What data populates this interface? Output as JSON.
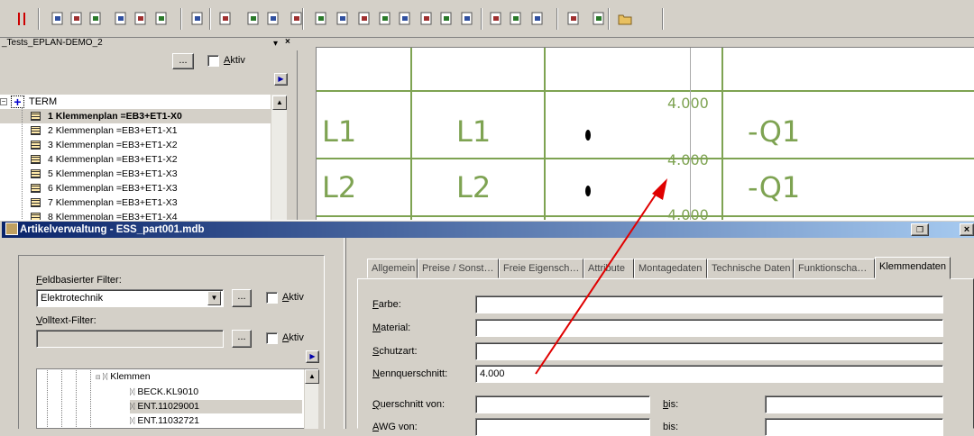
{
  "toolbar": {
    "icons": [
      "stop-icon",
      "copy-icon",
      "new-page-icon",
      "properties-icon",
      "move-up-icon",
      "move-down-icon",
      "move-right-icon",
      "table-icon",
      "report-icon",
      "select-icon",
      "connect-icon",
      "cross-ref-icon",
      "terminal-icon",
      "device-icon",
      "part-icon",
      "cable-icon",
      "plug-icon",
      "wire-icon",
      "edit-icon",
      "hatch-icon",
      "frame-icon",
      "window-icon",
      "window-text-icon",
      "cart-icon",
      "parts-db-icon",
      "open-folder-icon"
    ]
  },
  "panel": {
    "title": "_Tests_EPLAN-DEMO_2",
    "close": "×",
    "browse": "...",
    "aktiv": "Aktiv"
  },
  "tree": {
    "root": "TERM",
    "items": [
      "1 Klemmenplan =EB3+ET1-X0",
      "2 Klemmenplan =EB3+ET1-X1",
      "3 Klemmenplan =EB3+ET1-X2",
      "4 Klemmenplan =EB3+ET1-X2",
      "5 Klemmenplan =EB3+ET1-X3",
      "6 Klemmenplan =EB3+ET1-X3",
      "7 Klemmenplan =EB3+ET1-X3",
      "8 Klemmenplan =EB3+ET1-X4"
    ]
  },
  "drawing": {
    "cells": [
      "L1",
      "L1",
      "-Q1",
      "L2",
      "L2",
      "-Q1"
    ],
    "values": [
      "4.000",
      "4.000",
      "4.000"
    ],
    "colors": {
      "line": "#7ea352",
      "arrow": "#e00000"
    }
  },
  "dialog": {
    "title": "Artikelverwaltung - ESS_part001.mdb",
    "filter_label": "Feldbasierter Filter:",
    "filter_value": "Elektrotechnik",
    "volltext_label": "Volltext-Filter:",
    "browse": "...",
    "aktiv": "Aktiv",
    "tree_root": "Klemmen",
    "tree_items": [
      "BECK.KL9010",
      "ENT.11029001",
      "ENT.11032721"
    ],
    "tabs": [
      "Allgemein",
      "Preise / Sonst…",
      "Freie Eigensch…",
      "Attribute",
      "Montagedaten",
      "Technische Daten",
      "Funktionscha…",
      "Klemmendaten"
    ],
    "fields": {
      "farbe": {
        "label": "Farbe:",
        "value": ""
      },
      "material": {
        "label": "Material:",
        "value": ""
      },
      "schutzart": {
        "label": "Schutzart:",
        "value": ""
      },
      "nennquerschnitt": {
        "label": "Nennquerschnitt:",
        "value": "4.000"
      },
      "querschnitt_von": {
        "label": "Querschnitt von:",
        "value": ""
      },
      "bis1": {
        "label": "bis:",
        "value": ""
      },
      "awg_von": {
        "label": "AWG von:",
        "value": ""
      },
      "bis2": {
        "label": "bis:",
        "value": ""
      }
    }
  }
}
